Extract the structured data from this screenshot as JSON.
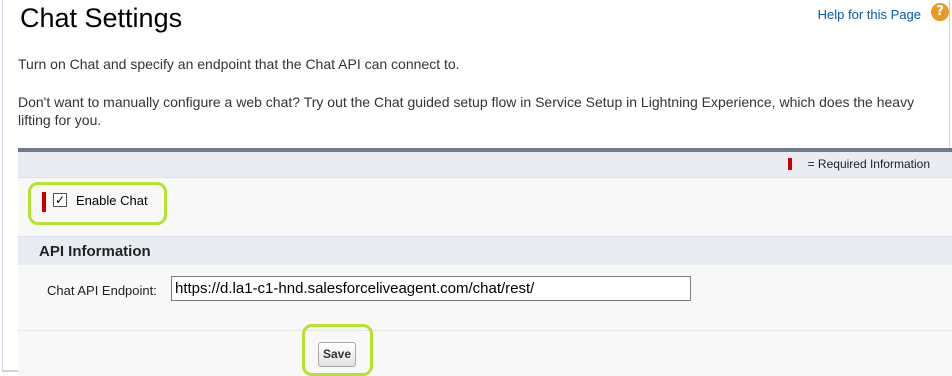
{
  "header": {
    "title": "Chat Settings",
    "help_link": "Help for this Page",
    "help_icon_glyph": "?"
  },
  "description": {
    "line1": "Turn on Chat and specify an endpoint that the Chat API can connect to.",
    "line2": "Don't want to manually configure a web chat? Try out the Chat guided setup flow in Service Setup in Lightning Experience, which does the heavy lifting for you."
  },
  "form": {
    "required_info": "= Required Information",
    "enable_chat": {
      "label": "Enable Chat",
      "checked": true,
      "glyph": "✓"
    },
    "api_section": {
      "title": "API Information",
      "endpoint_label": "Chat API Endpoint:",
      "endpoint_value": "https://d.la1-c1-hnd.salesforceliveagent.com/chat/rest/"
    },
    "save_label": "Save"
  },
  "colors": {
    "required": "#cc0000",
    "link": "#015ba7",
    "highlight": "#b7e22b",
    "help_icon": "#e69a1e"
  }
}
